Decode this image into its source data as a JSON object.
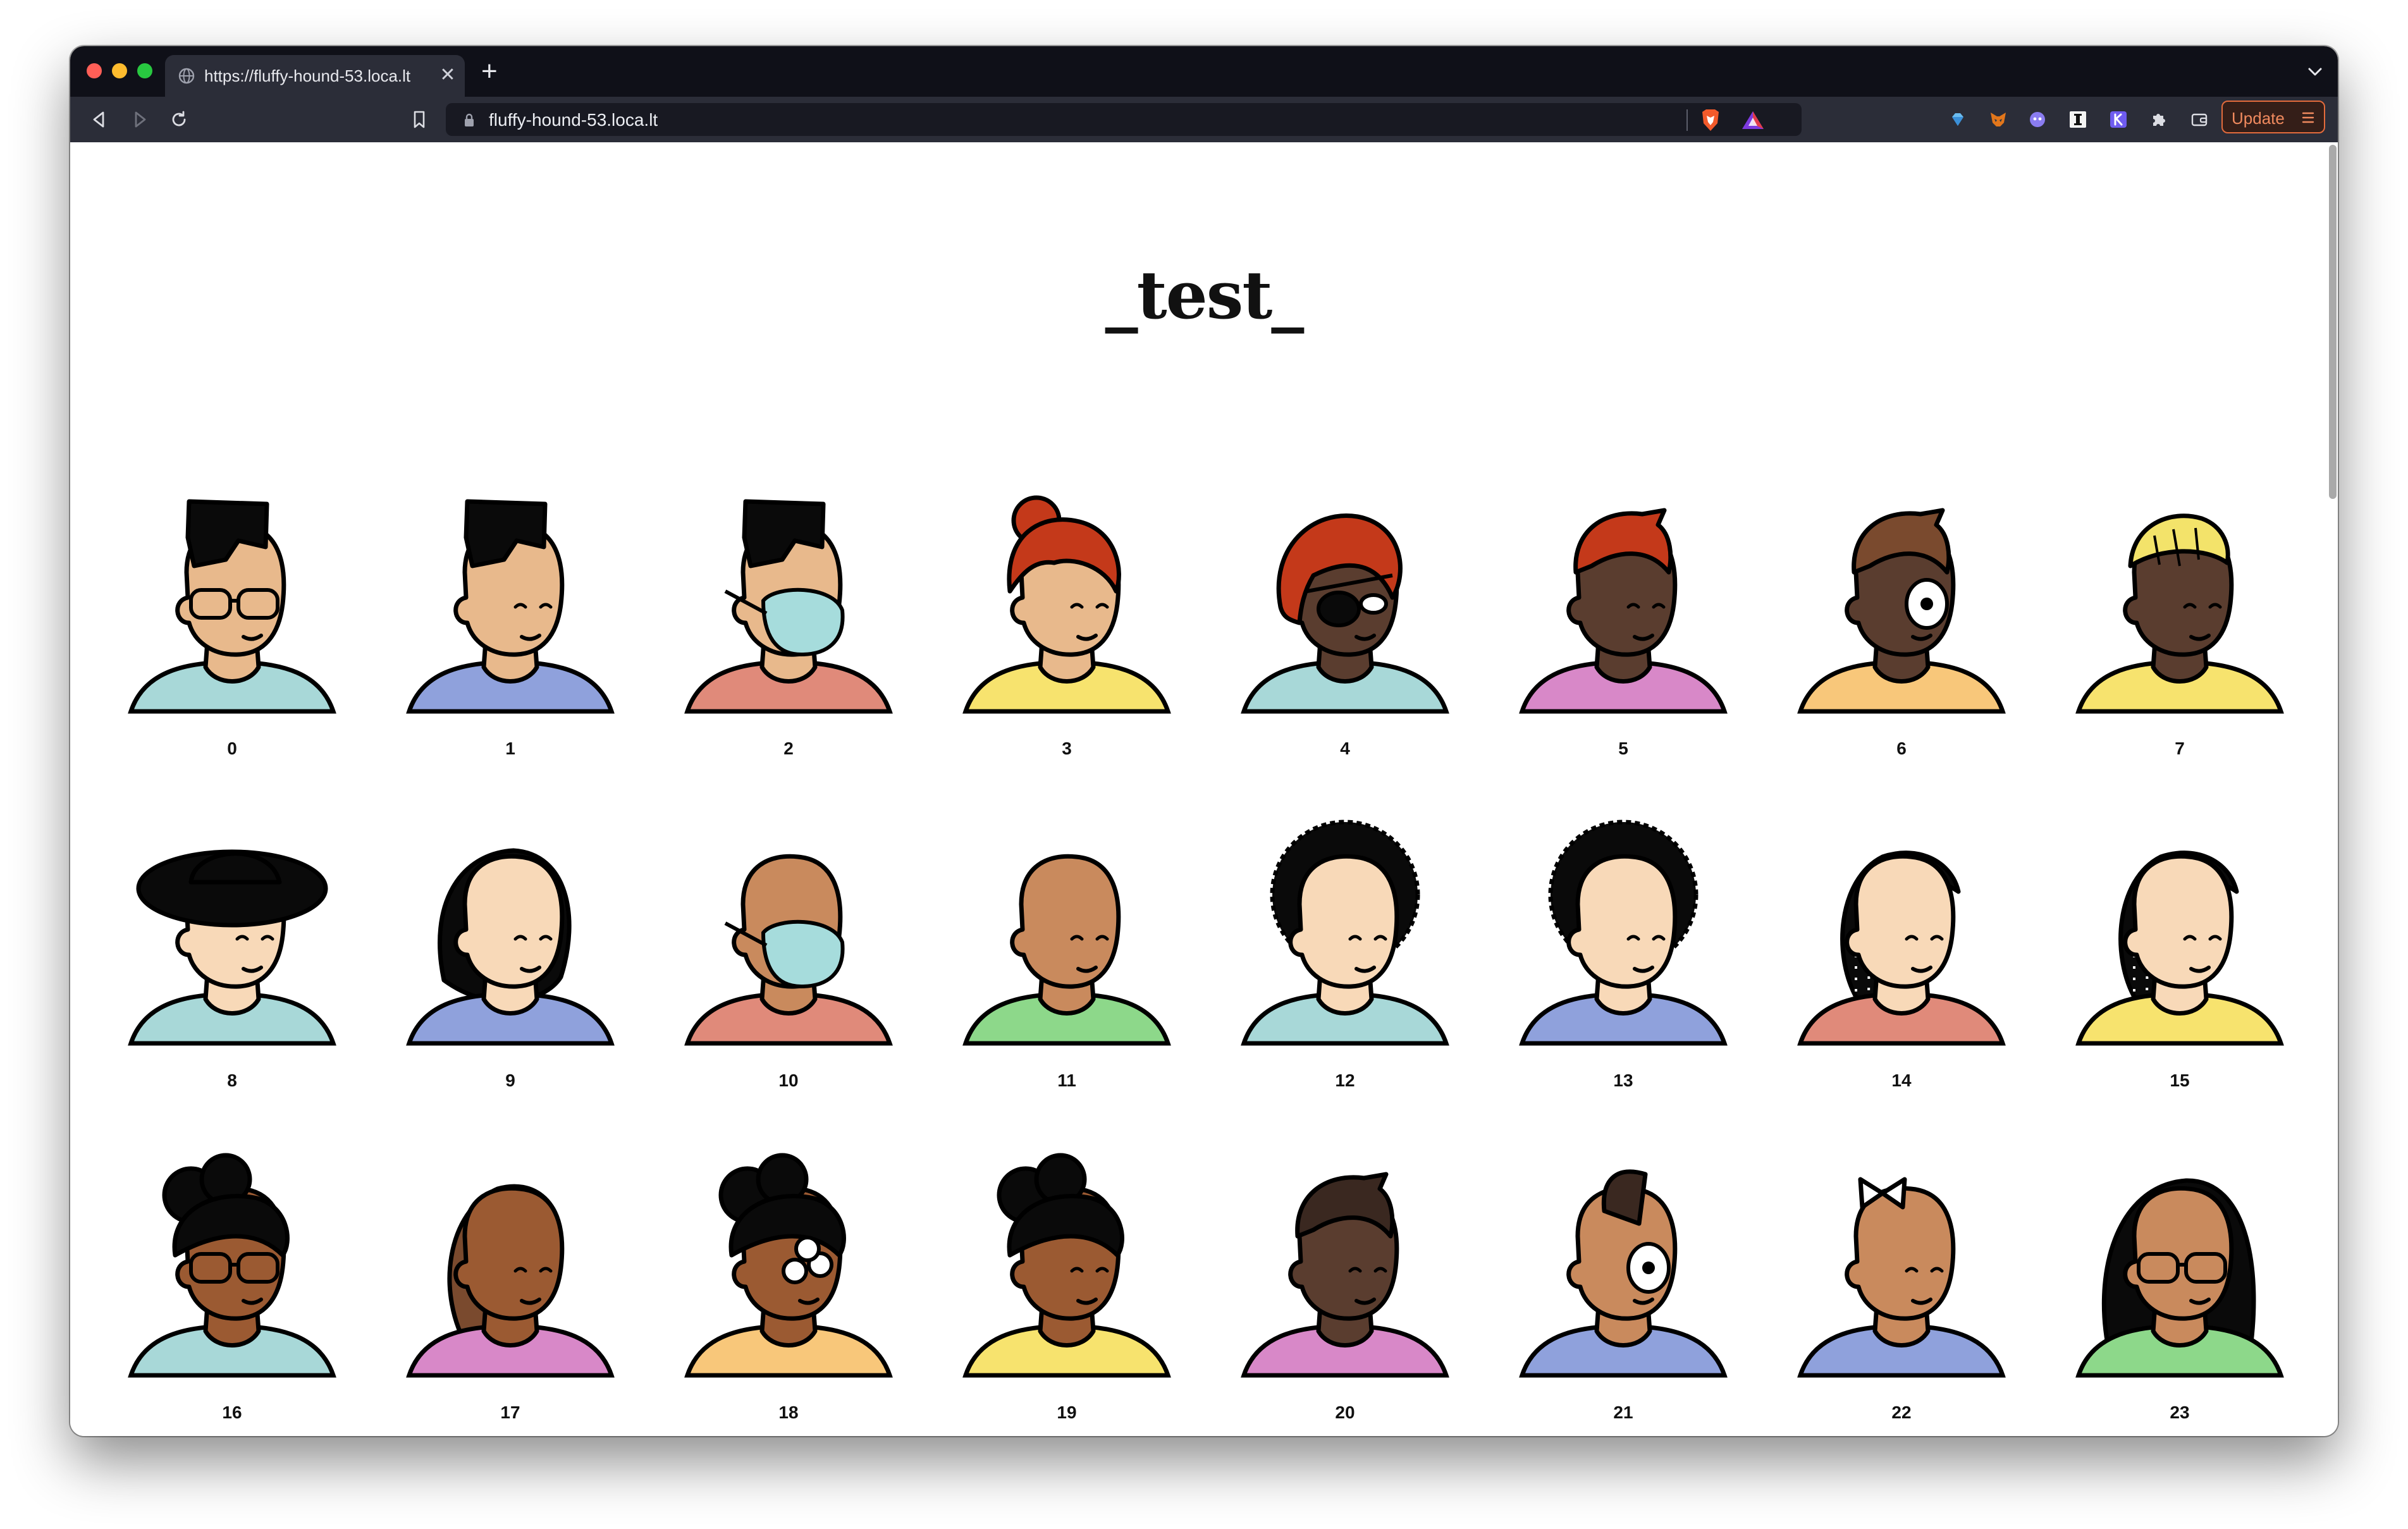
{
  "browser": {
    "tab_title": "https://fluffy-hound-53.loca.lt",
    "url": "fluffy-hound-53.loca.lt",
    "update_label": "Update",
    "traffic_lights": [
      "#ff5f57",
      "#febc2e",
      "#28c840"
    ],
    "accent": "#e36b3c"
  },
  "page": {
    "title": "_test_"
  },
  "avatars": [
    {
      "label": "0",
      "skin": "#e8b98c",
      "hair": "#0a0a0a",
      "shirt": "#a8d8d8",
      "hair_style": "flat",
      "accessory": "glasses"
    },
    {
      "label": "1",
      "skin": "#e8b98c",
      "hair": "#0a0a0a",
      "shirt": "#8fa1dc",
      "hair_style": "flat",
      "accessory": "none"
    },
    {
      "label": "2",
      "skin": "#e8b98c",
      "hair": "#0a0a0a",
      "shirt": "#e08a7a",
      "hair_style": "flat",
      "accessory": "mask"
    },
    {
      "label": "3",
      "skin": "#e8b98c",
      "hair": "#c4391a",
      "shirt": "#f7e36e",
      "hair_style": "bun",
      "accessory": "none"
    },
    {
      "label": "4",
      "skin": "#5a3d2f",
      "hair": "#c4391a",
      "shirt": "#a8d8d8",
      "hair_style": "bob",
      "accessory": "eyepatch"
    },
    {
      "label": "5",
      "skin": "#5a3d2f",
      "hair": "#c4391a",
      "shirt": "#d888c8",
      "hair_style": "short",
      "accessory": "none"
    },
    {
      "label": "6",
      "skin": "#5a3d2f",
      "hair": "#7a4a2e",
      "shirt": "#f8c77a",
      "hair_style": "short",
      "accessory": "cyclops"
    },
    {
      "label": "7",
      "skin": "#5a3d2f",
      "hair": "#f3e36a",
      "shirt": "#f7e36e",
      "hair_style": "beanie",
      "accessory": "none"
    },
    {
      "label": "8",
      "skin": "#f8d9b8",
      "hair": "#0a0a0a",
      "shirt": "#a8d8d8",
      "hair_style": "hat",
      "accessory": "none"
    },
    {
      "label": "9",
      "skin": "#f8d9b8",
      "hair": "#0a0a0a",
      "shirt": "#8fa1dc",
      "hair_style": "hijab",
      "accessory": "none"
    },
    {
      "label": "10",
      "skin": "#c98a5d",
      "hair": "#c98a5d",
      "shirt": "#e08a7a",
      "hair_style": "bald",
      "accessory": "mask"
    },
    {
      "label": "11",
      "skin": "#c98a5d",
      "hair": "#c98a5d",
      "shirt": "#8dd88a",
      "hair_style": "bald",
      "accessory": "none"
    },
    {
      "label": "12",
      "skin": "#f8d9b8",
      "hair": "#0a0a0a",
      "shirt": "#a8d8d8",
      "hair_style": "afro",
      "accessory": "none"
    },
    {
      "label": "13",
      "skin": "#f8d9b8",
      "hair": "#0a0a0a",
      "shirt": "#8fa1dc",
      "hair_style": "afro",
      "accessory": "none"
    },
    {
      "label": "14",
      "skin": "#f8d9b8",
      "hair": "#0a0a0a",
      "shirt": "#e08a7a",
      "hair_style": "braids",
      "accessory": "none"
    },
    {
      "label": "15",
      "skin": "#f8d9b8",
      "hair": "#0a0a0a",
      "shirt": "#f7e36e",
      "hair_style": "braids",
      "accessory": "none"
    },
    {
      "label": "16",
      "skin": "#9b5a32",
      "hair": "#0a0a0a",
      "shirt": "#a8d8d8",
      "hair_style": "puffs",
      "accessory": "glasses"
    },
    {
      "label": "17",
      "skin": "#9b5a32",
      "hair": "#7a4a2e",
      "shirt": "#d888c8",
      "hair_style": "ponytail",
      "accessory": "none"
    },
    {
      "label": "18",
      "skin": "#9b5a32",
      "hair": "#0a0a0a",
      "shirt": "#f8c77a",
      "hair_style": "puffs",
      "accessory": "three-eyes"
    },
    {
      "label": "19",
      "skin": "#9b5a32",
      "hair": "#0a0a0a",
      "shirt": "#f7e36e",
      "hair_style": "puffs",
      "accessory": "none"
    },
    {
      "label": "20",
      "skin": "#5a3d2f",
      "hair": "#3a2820",
      "shirt": "#d888c8",
      "hair_style": "short",
      "accessory": "none"
    },
    {
      "label": "21",
      "skin": "#c98a5d",
      "hair": "#3a2820",
      "shirt": "#8fa1dc",
      "hair_style": "mohawk",
      "accessory": "cyclops"
    },
    {
      "label": "22",
      "skin": "#c98a5d",
      "hair": "#c98a5d",
      "shirt": "#8fa1dc",
      "hair_style": "bow",
      "accessory": "none"
    },
    {
      "label": "23",
      "skin": "#c98a5d",
      "hair": "#0a0a0a",
      "shirt": "#8dd88a",
      "hair_style": "long",
      "accessory": "glasses"
    }
  ]
}
